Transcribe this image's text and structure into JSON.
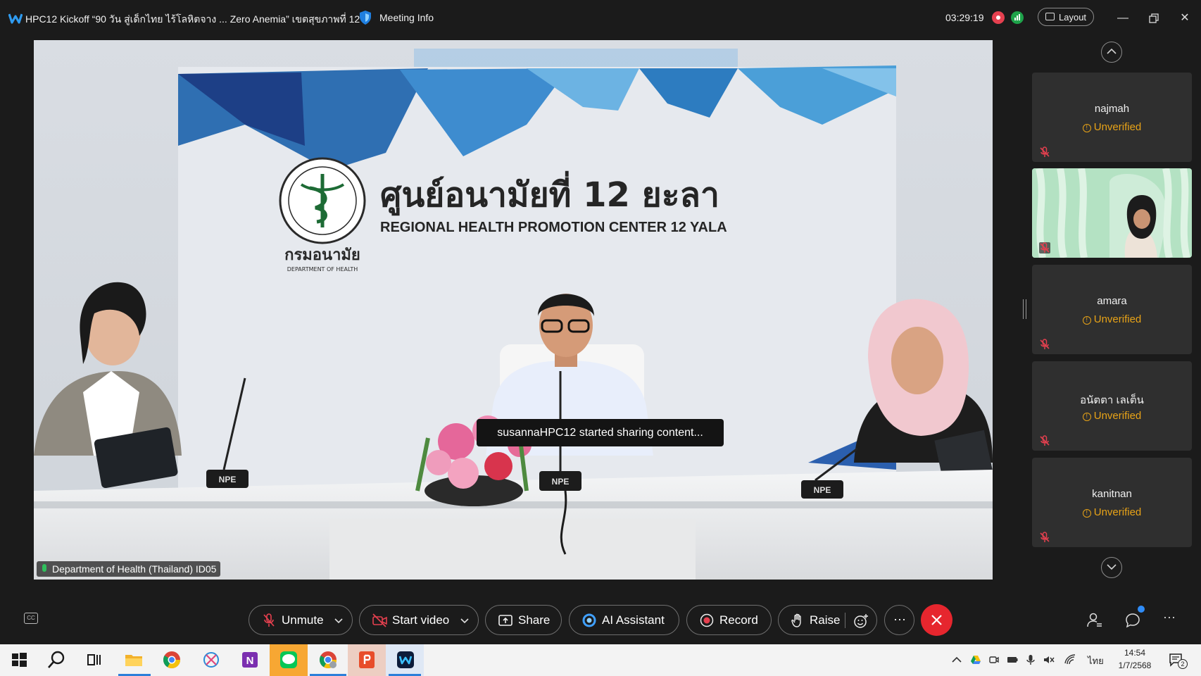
{
  "window": {
    "title": "HPC12 Kickoff “90 วัน สู่เด็กไทย ไร้โลหิตจาง ... Zero Anemia” เขตสุขภาพที่ 12",
    "meeting_info": "Meeting Info",
    "elapsed_time": "03:29:19",
    "layout_label": "Layout"
  },
  "main_video": {
    "participant_label": "Department of Health (Thailand) ID05",
    "toast": "susannaHPC12 started sharing content...",
    "backdrop_thai_title": "ศูนย์อนามัยที่ 12 ยะลา",
    "backdrop_english_title": "REGIONAL HEALTH PROMOTION CENTER 12 YALA",
    "logo_thai": "กรมอนามัย",
    "logo_english": "DEPARTMENT OF HEALTH",
    "mic_brand": "NPE"
  },
  "participants": [
    {
      "name": "najmah",
      "status": "Unverified",
      "muted": true,
      "video": false
    },
    {
      "name": "",
      "status": "",
      "muted": true,
      "video": true
    },
    {
      "name": "amara",
      "status": "Unverified",
      "muted": true,
      "video": false
    },
    {
      "name": "อนัตตา เลเต็น",
      "status": "Unverified",
      "muted": true,
      "video": false
    },
    {
      "name": "kanitnan",
      "status": "Unverified",
      "muted": true,
      "video": false
    }
  ],
  "toolbar": {
    "unmute": "Unmute",
    "start_video": "Start video",
    "share": "Share",
    "ai_assistant": "AI Assistant",
    "record": "Record",
    "raise": "Raise",
    "more": "···"
  },
  "taskbar": {
    "apps": [
      "start-icon",
      "search-icon",
      "task-view-icon",
      "file-explorer-icon",
      "chrome-icon",
      "snip-icon",
      "onenote-icon",
      "line-icon",
      "chrome-profile-icon",
      "office-icon",
      "webex-icon"
    ],
    "language": "ไทย",
    "time": "14:54",
    "date": "1/7/2568",
    "notification_count": "2"
  },
  "colors": {
    "accent_end": "#e6262e",
    "unverified": "#e8a317",
    "background": "#1b1b1b"
  }
}
